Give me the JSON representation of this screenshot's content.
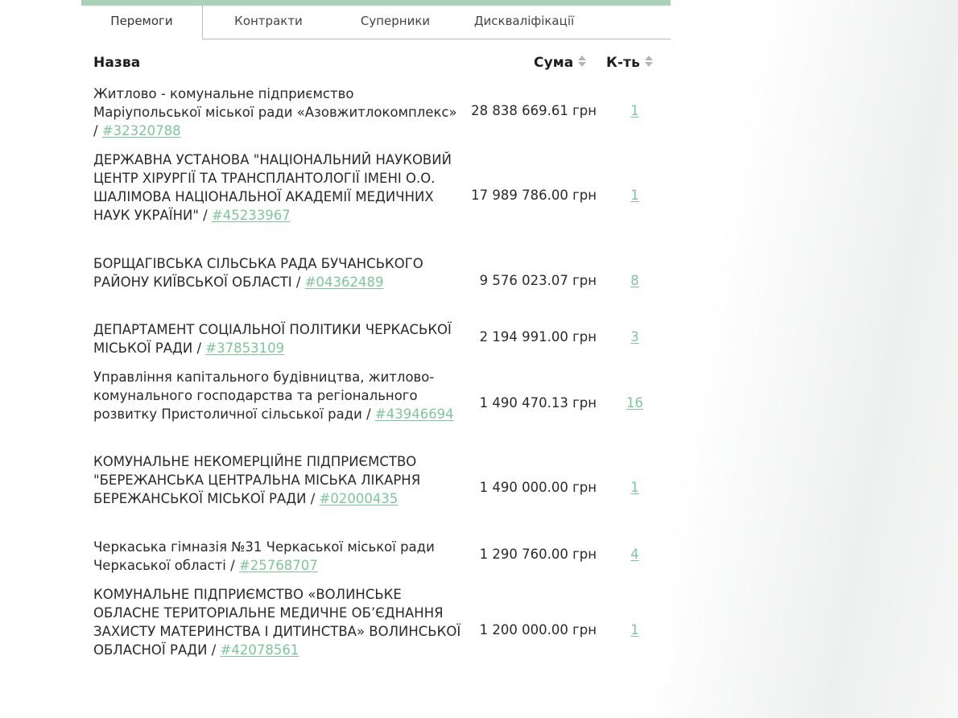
{
  "tabs": [
    {
      "label": "Перемоги",
      "active": true
    },
    {
      "label": "Контракти",
      "active": false
    },
    {
      "label": "Суперники",
      "active": false
    },
    {
      "label": "Дискваліфікації",
      "active": false
    }
  ],
  "table": {
    "headers": {
      "name": "Назва",
      "sum": "Сума",
      "count": "К-ть"
    },
    "rows": [
      {
        "name": "Житлово - комунальне підприємство Маріупольської міської ради «Азовжитлокомплекс» / ",
        "code": "#32320788",
        "sum": "28 838 669.61 грн",
        "count": "1"
      },
      {
        "name": "ДЕРЖАВНА УСТАНОВА \"НАЦІОНАЛЬНИЙ НАУКОВИЙ ЦЕНТР ХІРУРГІЇ ТА ТРАНСПЛАНТОЛОГІЇ ІМЕНІ О.О. ШАЛІМОВА НАЦІОНАЛЬНОЇ АКАДЕМІЇ МЕДИЧНИХ НАУК УКРАЇНИ\" / ",
        "code": "#45233967",
        "sum": "17 989 786.00 грн",
        "count": "1"
      },
      {
        "name": "БОРЩАГІВСЬКА СІЛЬСЬКА РАДА БУЧАНСЬКОГО РАЙОНУ КИЇВСЬКОЇ ОБЛАСТІ / ",
        "code": "#04362489",
        "sum": "9 576 023.07 грн",
        "count": "8"
      },
      {
        "name": "ДЕПАРТАМЕНТ СОЦІАЛЬНОЇ ПОЛІТИКИ ЧЕРКАСЬКОЇ МІСЬКОЇ РАДИ / ",
        "code": "#37853109",
        "sum": "2 194 991.00 грн",
        "count": "3"
      },
      {
        "name": "Управління капітального будівництва, житлово-комунального господарства та регіонального розвитку Пристоличної сільської ради / ",
        "code": "#43946694",
        "sum": "1 490 470.13 грн",
        "count": "16"
      },
      {
        "name": "КОМУНАЛЬНЕ НЕКОМЕРЦІЙНЕ ПІДПРИЄМСТВО \"БЕРЕЖАНСЬКА ЦЕНТРАЛЬНА МІСЬКА ЛІКАРНЯ БЕРЕЖАНСЬКОЇ МІСЬКОЇ РАДИ / ",
        "code": "#02000435",
        "sum": "1 490 000.00 грн",
        "count": "1"
      },
      {
        "name": "Черкаська гімназія №31 Черкаської міської ради Черкаської області / ",
        "code": "#25768707",
        "sum": "1 290 760.00 грн",
        "count": "4"
      },
      {
        "name": "КОМУНАЛЬНЕ ПІДПРИЄМСТВО «ВОЛИНСЬКЕ ОБЛАСНЕ ТЕРИТОРІАЛЬНЕ МЕДИЧНЕ ОБ’ЄДНАННЯ ЗАХИСТУ МАТЕРИНСТВА І ДИТИНСТВА» ВОЛИНСЬКОЇ ОБЛАСНОЇ РАДИ / ",
        "code": "#42078561",
        "sum": "1 200 000.00 грн",
        "count": "1"
      }
    ]
  },
  "colors": {
    "accent": "#7cc79a",
    "top_bar": "#a9d2b8",
    "text": "#2a2a2a",
    "sort_icon": "#b4b4b4"
  },
  "icons": {
    "sort": "sort-up-down-icon"
  }
}
